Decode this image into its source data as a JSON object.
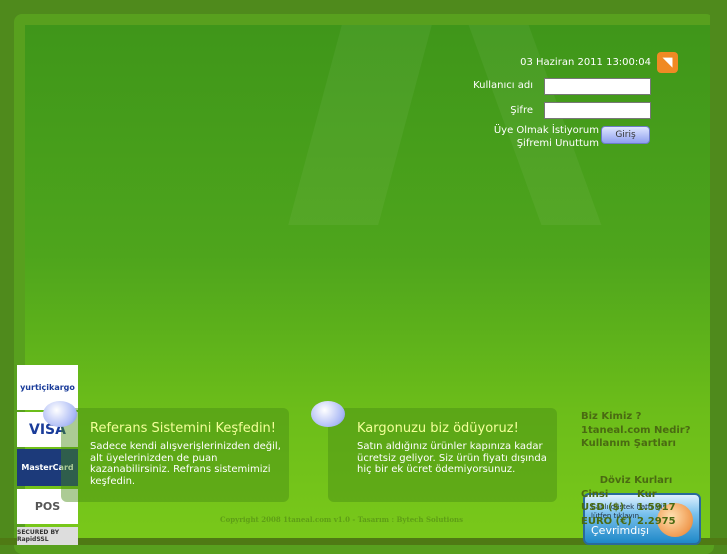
{
  "header": {
    "datetime": "03 Haziran 2011 13:00:04",
    "rss_icon": "rss-icon"
  },
  "login": {
    "username_label": "Kullanıcı adı",
    "password_label": "Şifre",
    "username_value": "",
    "password_value": "",
    "register_link": "Üye Olmak İstiyorum",
    "forgot_link": "Şifremi Unuttum",
    "submit_label": "Giriş"
  },
  "logos": [
    "yurtiçikargo",
    "VISA",
    "MasterCard",
    "POS",
    "SECURED BY RapidSSL"
  ],
  "promos": [
    {
      "title": "Referans Sistemini Keşfedin!",
      "text": "Sadece kendi alışverişlerinizden değil, alt üyelerinizden de puan kazanabilirsiniz. Refrans sistemimizi keşfedin."
    },
    {
      "title": "Kargonuzu biz ödüyoruz!",
      "text": "Satın aldığınız ürünler kapınıza kadar ücretsiz geliyor. Siz ürün fiyatı dışında hiç bir ek ücret ödemiyorsunuz."
    }
  ],
  "links": [
    "Biz Kimiz ?",
    "1taneal.com Nedir?",
    "Kullanım Şartları"
  ],
  "currency": {
    "title": "Döviz Kurları",
    "col_type": "Cinsi",
    "col_rate": "Kur",
    "rows": [
      {
        "name": "USD ($)",
        "rate": "1.5917"
      },
      {
        "name": "EURO (€)",
        "rate": "2.2975"
      }
    ]
  },
  "footer": {
    "copyright": "Copyright 2008 1taneal.com v1.0 - Tasarım : Bytech Solutions"
  },
  "chat": {
    "status": "Çevrimdışı",
    "line1": "Canlı destek hattı için",
    "line2": "lütfen tıklayın"
  }
}
